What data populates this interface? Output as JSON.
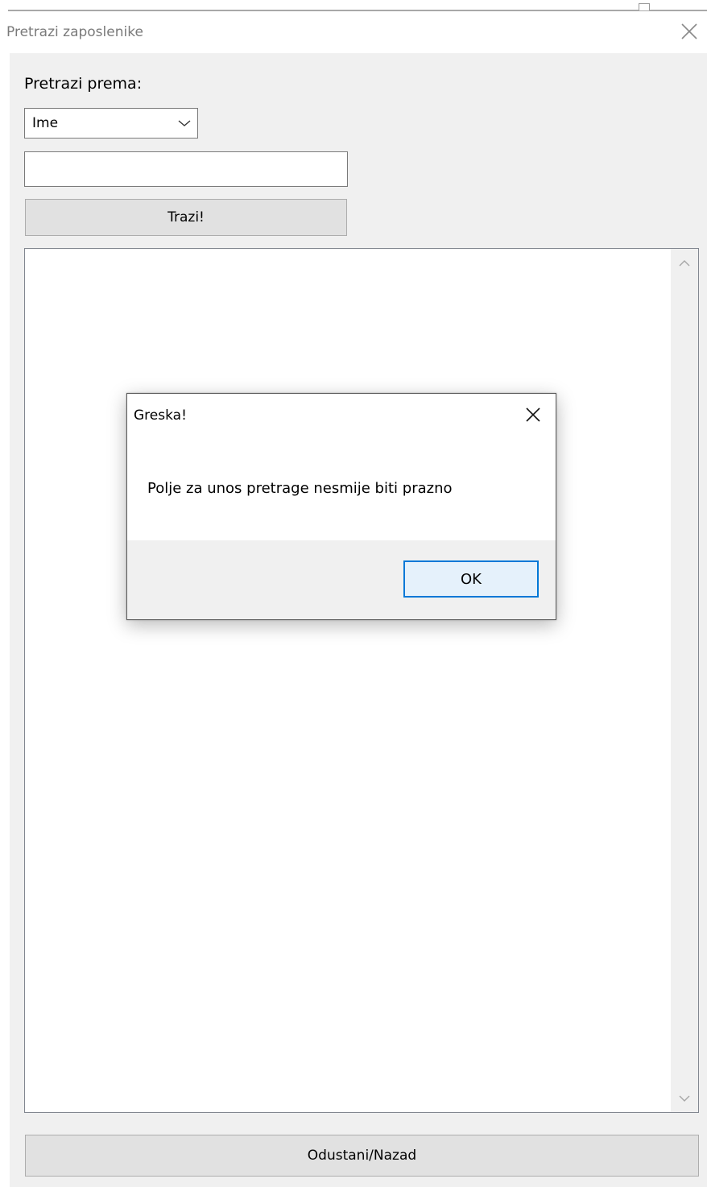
{
  "window": {
    "title": "Pretrazi zaposlenike"
  },
  "form": {
    "search_by_label": "Pretrazi prema:",
    "search_by_selected": "Ime",
    "search_input_value": "",
    "search_input_placeholder": "",
    "search_button_label": "Trazi!",
    "back_button_label": "Odustani/Nazad"
  },
  "dialog": {
    "title": "Greska!",
    "message": "Polje za unos pretrage nesmije biti prazno",
    "ok_label": "OK"
  },
  "icons": {
    "window_close": "close-icon",
    "dialog_close": "close-icon",
    "combo_arrow": "chevron-down-icon",
    "scroll_up": "chevron-up-icon",
    "scroll_down": "chevron-down-icon"
  },
  "colors": {
    "accent": "#0078d7",
    "window_bg": "#f0f0f0",
    "title_text": "#7a7a7a"
  }
}
